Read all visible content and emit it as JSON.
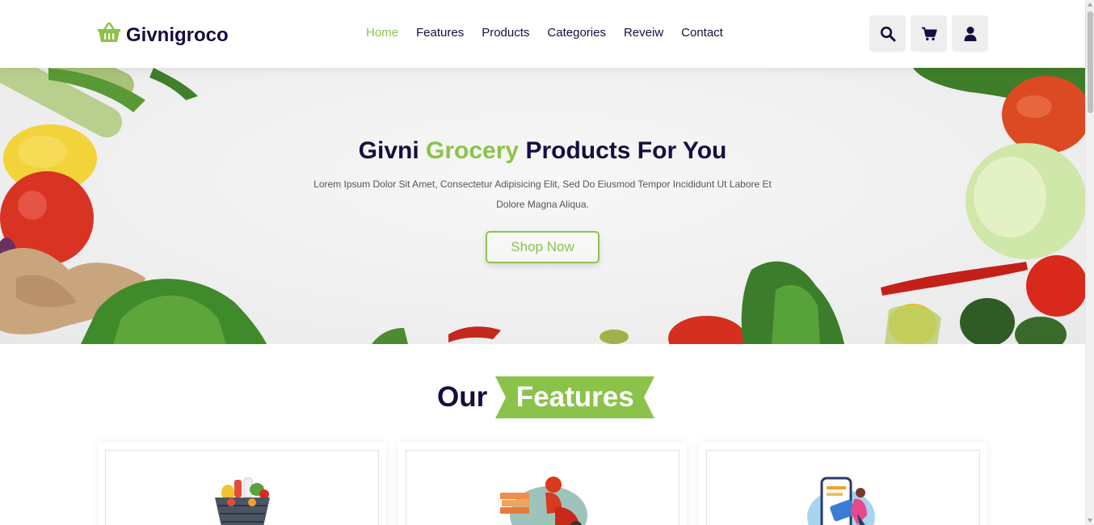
{
  "brand": {
    "name": "Givnigroco",
    "icon": "shopping-basket-icon",
    "accent": "#8bc34a",
    "dark": "#130f40"
  },
  "nav": {
    "items": [
      {
        "label": "Home",
        "active": true
      },
      {
        "label": "Features",
        "active": false
      },
      {
        "label": "Products",
        "active": false
      },
      {
        "label": "Categories",
        "active": false
      },
      {
        "label": "Reveiw",
        "active": false
      },
      {
        "label": "Contact",
        "active": false
      }
    ]
  },
  "header_icons": [
    "search-icon",
    "cart-icon",
    "user-icon"
  ],
  "hero": {
    "title_part1": "Givni",
    "title_accent": "Grocery",
    "title_part2": "Products For You",
    "description": "Lorem Ipsum Dolor Sit Amet, Consectetur Adipisicing Elit, Sed Do Eiusmod Tempor Incididunt Ut Labore Et Dolore Magna Aliqua.",
    "button": "Shop Now"
  },
  "features": {
    "heading_plain": "Our",
    "heading_accent": "Features",
    "cards": [
      {
        "image": "grocery-basket-illustration"
      },
      {
        "image": "delivery-scooter-illustration"
      },
      {
        "image": "mobile-payment-illustration"
      }
    ]
  }
}
